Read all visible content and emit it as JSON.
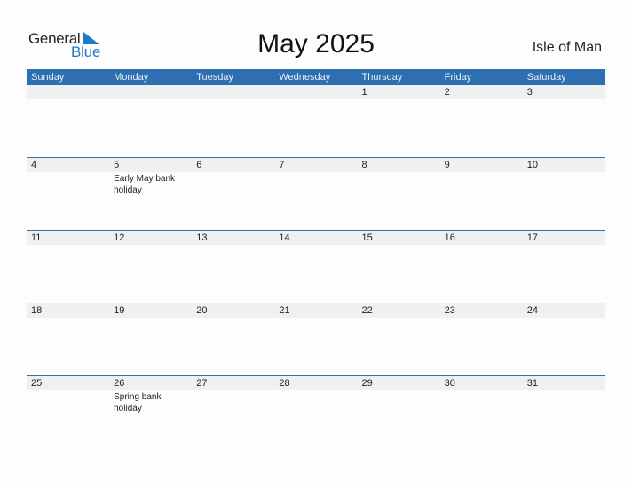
{
  "logo": {
    "line1": "General",
    "line2": "Blue",
    "icon": "triangle-flag-icon"
  },
  "title": "May 2025",
  "country": "Isle of Man",
  "colors": {
    "header_bg": "#2e6fb2",
    "date_strip": "#f0f0f0",
    "logo_blue": "#1e7bc9"
  },
  "weekdays": [
    "Sunday",
    "Monday",
    "Tuesday",
    "Wednesday",
    "Thursday",
    "Friday",
    "Saturday"
  ],
  "weeks": [
    {
      "days": [
        {
          "n": "",
          "e": ""
        },
        {
          "n": "",
          "e": ""
        },
        {
          "n": "",
          "e": ""
        },
        {
          "n": "",
          "e": ""
        },
        {
          "n": "1",
          "e": ""
        },
        {
          "n": "2",
          "e": ""
        },
        {
          "n": "3",
          "e": ""
        }
      ]
    },
    {
      "days": [
        {
          "n": "4",
          "e": ""
        },
        {
          "n": "5",
          "e": "Early May bank holiday"
        },
        {
          "n": "6",
          "e": ""
        },
        {
          "n": "7",
          "e": ""
        },
        {
          "n": "8",
          "e": ""
        },
        {
          "n": "9",
          "e": ""
        },
        {
          "n": "10",
          "e": ""
        }
      ]
    },
    {
      "days": [
        {
          "n": "11",
          "e": ""
        },
        {
          "n": "12",
          "e": ""
        },
        {
          "n": "13",
          "e": ""
        },
        {
          "n": "14",
          "e": ""
        },
        {
          "n": "15",
          "e": ""
        },
        {
          "n": "16",
          "e": ""
        },
        {
          "n": "17",
          "e": ""
        }
      ]
    },
    {
      "days": [
        {
          "n": "18",
          "e": ""
        },
        {
          "n": "19",
          "e": ""
        },
        {
          "n": "20",
          "e": ""
        },
        {
          "n": "21",
          "e": ""
        },
        {
          "n": "22",
          "e": ""
        },
        {
          "n": "23",
          "e": ""
        },
        {
          "n": "24",
          "e": ""
        }
      ]
    },
    {
      "days": [
        {
          "n": "25",
          "e": ""
        },
        {
          "n": "26",
          "e": "Spring bank holiday"
        },
        {
          "n": "27",
          "e": ""
        },
        {
          "n": "28",
          "e": ""
        },
        {
          "n": "29",
          "e": ""
        },
        {
          "n": "30",
          "e": ""
        },
        {
          "n": "31",
          "e": ""
        }
      ]
    }
  ]
}
